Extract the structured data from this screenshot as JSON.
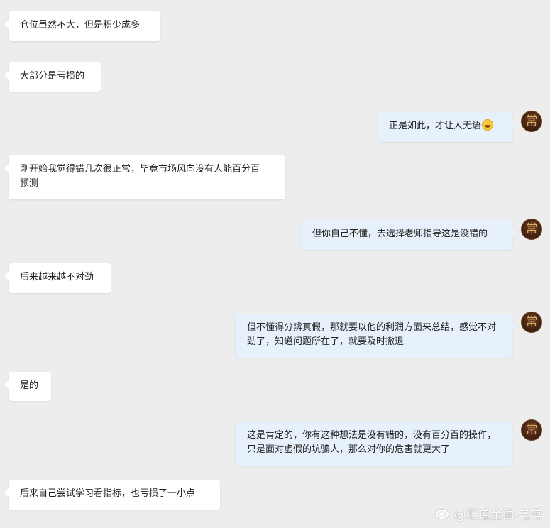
{
  "messages": [
    {
      "side": "left",
      "text": "仓位虽然不大，但是积少成多"
    },
    {
      "side": "left",
      "text": "大部分是亏损的"
    },
    {
      "side": "right",
      "text": "正是如此，才让人无语",
      "emoji": "laughing-tears-emoji"
    },
    {
      "side": "left",
      "text": "刚开始我觉得错几次很正常，毕竟市场风向没有人能百分百预测"
    },
    {
      "side": "right",
      "text": "但你自己不懂，去选择老师指导这是没错的"
    },
    {
      "side": "left",
      "text": "后来越来越不对劲"
    },
    {
      "side": "right",
      "text": "但不懂得分辨真假，那就要以他的利润方面来总结，感觉不对劲了，知道问题所在了，就要及时撤退"
    },
    {
      "side": "left",
      "text": "是的"
    },
    {
      "side": "right",
      "text": "这是肯定的，你有这种想法是没有错的，没有百分百的操作，只是面对虚假的坑骗人，那么对你的危害就更大了"
    },
    {
      "side": "left",
      "text": "后来自己尝试学习看指标，也亏损了一小点"
    }
  ],
  "avatar": {
    "glyph": "常",
    "icon": "advisor-avatar"
  },
  "watermark": {
    "text": "@汇道金油-老常",
    "icon": "weibo-icon"
  },
  "colors": {
    "background": "#ededed",
    "left_bubble": "#ffffff",
    "right_bubble": "#e6f1fb",
    "avatar_glyph": "#d9ae63"
  }
}
